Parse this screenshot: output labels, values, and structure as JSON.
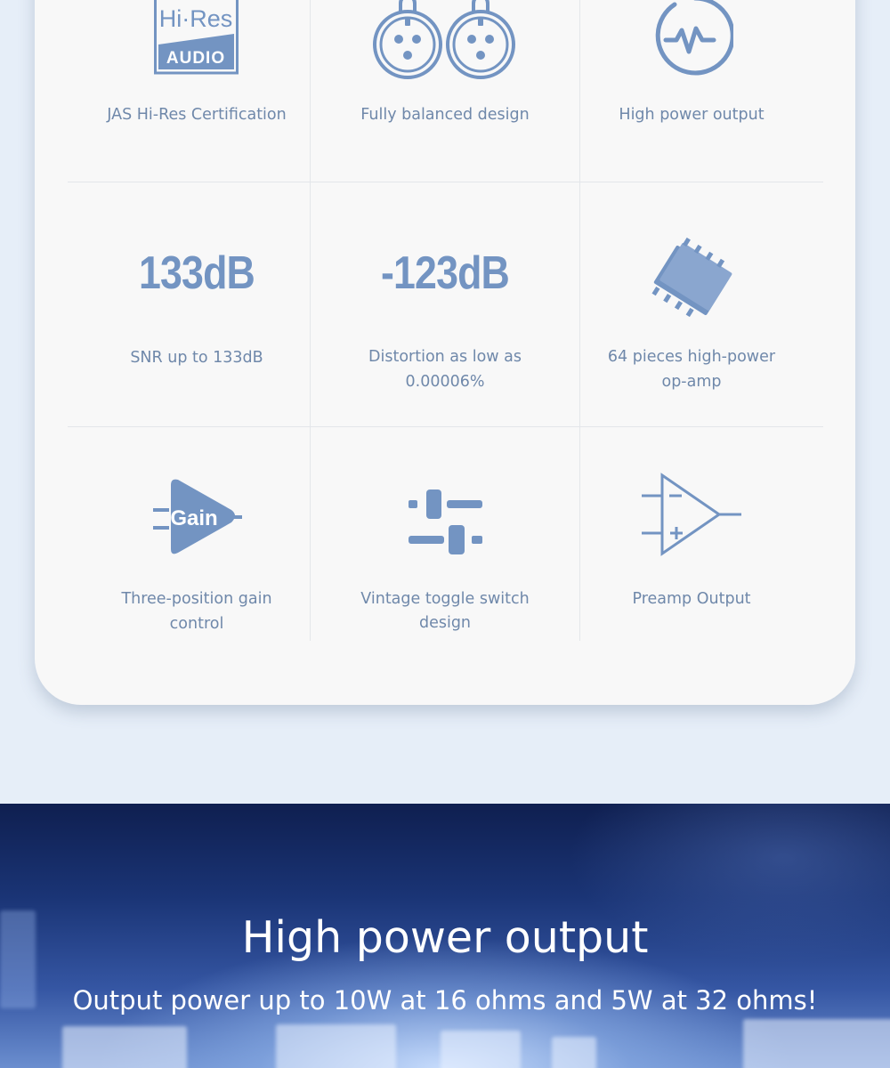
{
  "features": [
    {
      "icon": "hi-res-audio-logo",
      "label": "JAS Hi-Res Certification"
    },
    {
      "icon": "xlr-connector-icon",
      "label": "Fully balanced design"
    },
    {
      "icon": "power-pulse-icon",
      "label": "High power output"
    },
    {
      "big": "133dB",
      "label": "SNR up to 133dB"
    },
    {
      "big": "-123dB",
      "label_line1": "Distortion as low as",
      "label_line2": "0.00006%"
    },
    {
      "icon": "chip-icon",
      "label_line1": "64 pieces high-power",
      "label_line2": "op-amp"
    },
    {
      "icon": "gain-icon",
      "label_line1": "Three-position gain",
      "label_line2": "control"
    },
    {
      "icon": "toggle-switch-icon",
      "label_line1": "Vintage toggle switch",
      "label_line2": "design"
    },
    {
      "icon": "op-amp-symbol-icon",
      "label": "Preamp Output"
    }
  ],
  "logo_text": {
    "top": "Hi·Res",
    "bottom": "AUDIO"
  },
  "gain_text": "Gain",
  "hero": {
    "title": "High power output",
    "subtitle": "Output power up to 10W at 16 ohms and 5W at 32 ohms!"
  },
  "colors": {
    "accent": "#7394c2",
    "label": "#6f88aa",
    "card": "#f8f8f8",
    "page": "#e6eef8"
  }
}
